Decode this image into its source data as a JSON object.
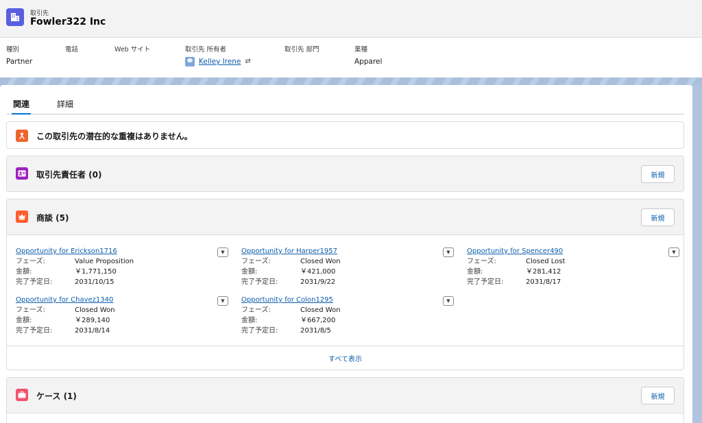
{
  "record": {
    "object_label": "取引先",
    "name": "Fowler322 Inc",
    "icon": "account-building-icon",
    "icon_color": "#5a5fe0"
  },
  "highlights": {
    "type": {
      "label": "種別",
      "value": "Partner"
    },
    "phone": {
      "label": "電話",
      "value": ""
    },
    "website": {
      "label": "Web サイト",
      "value": ""
    },
    "owner": {
      "label": "取引先 所有者",
      "value": "Kelley Irene"
    },
    "department": {
      "label": "取引先 部門",
      "value": ""
    },
    "industry": {
      "label": "業種",
      "value": "Apparel"
    }
  },
  "tabs": [
    {
      "label": "関連",
      "active": true
    },
    {
      "label": "詳細",
      "active": false
    }
  ],
  "duplicates": {
    "message": "この取引先の潜在的な重複はありません。",
    "icon": "duplicate-icon",
    "icon_color": "#f0632d"
  },
  "contacts_card": {
    "title": "取引先責任者 (0)",
    "new_label": "新規",
    "icon": "contact-icon",
    "icon_color": "#a020c0"
  },
  "opportunities_card": {
    "title": "商談 (5)",
    "new_label": "新規",
    "icon": "opportunity-crown-icon",
    "icon_color": "#ff5d2d",
    "field_labels": {
      "stage": "フェーズ:",
      "amount": "金額:",
      "close_date": "完了予定日:"
    },
    "items": [
      {
        "name": "Opportunity for Erickson1716",
        "stage": "Value Proposition",
        "amount": "￥1,771,150",
        "close_date": "2031/10/15"
      },
      {
        "name": "Opportunity for Harper1957",
        "stage": "Closed Won",
        "amount": "￥421,000",
        "close_date": "2031/9/22"
      },
      {
        "name": "Opportunity for Spencer490",
        "stage": "Closed Lost",
        "amount": "￥281,412",
        "close_date": "2031/8/17"
      },
      {
        "name": "Opportunity for Chavez1340",
        "stage": "Closed Won",
        "amount": "￥289,140",
        "close_date": "2031/8/14"
      },
      {
        "name": "Opportunity for Colon1295",
        "stage": "Closed Won",
        "amount": "￥667,200",
        "close_date": "2031/8/5"
      }
    ],
    "view_all_label": "すべて表示"
  },
  "cases_card": {
    "title": "ケース (1)",
    "new_label": "新規",
    "icon": "case-briefcase-icon",
    "icon_color": "#f2536d"
  }
}
